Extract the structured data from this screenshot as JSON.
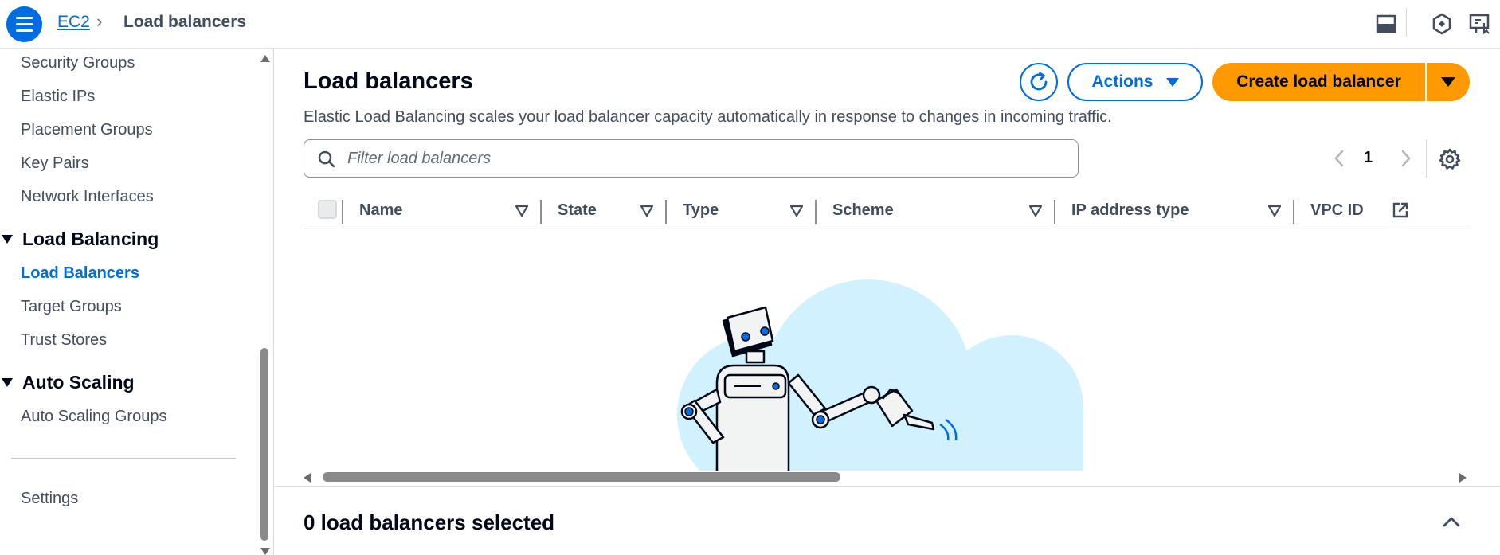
{
  "breadcrumb": {
    "parent": "EC2",
    "separator": "›",
    "current": "Load balancers"
  },
  "sidebar": {
    "items_top": [
      {
        "label": "Security Groups"
      },
      {
        "label": "Elastic IPs"
      },
      {
        "label": "Placement Groups"
      },
      {
        "label": "Key Pairs"
      },
      {
        "label": "Network Interfaces"
      }
    ],
    "section_load_balancing": "Load Balancing",
    "items_lb": [
      {
        "label": "Load Balancers",
        "active": true
      },
      {
        "label": "Target Groups"
      },
      {
        "label": "Trust Stores"
      }
    ],
    "section_auto_scaling": "Auto Scaling",
    "items_as": [
      {
        "label": "Auto Scaling Groups"
      }
    ],
    "settings": "Settings"
  },
  "main": {
    "title": "Load balancers",
    "description": "Elastic Load Balancing scales your load balancer capacity automatically in response to changes in incoming traffic.",
    "actions_label": "Actions",
    "create_label": "Create load balancer",
    "filter_placeholder": "Filter load balancers",
    "page_number": "1",
    "columns": [
      "Name",
      "State",
      "Type",
      "Scheme",
      "IP address type",
      "VPC ID"
    ]
  },
  "bottom": {
    "selected_text": "0 load balancers selected"
  },
  "colors": {
    "accent": "#006ce0",
    "primary_button": "#ff9900",
    "illustration_cloud": "#d1f1ff"
  },
  "icons": [
    "menu-icon",
    "chevron-right-icon",
    "split-panel-icon",
    "hexagon-icon",
    "display-icon",
    "refresh-icon",
    "search-icon",
    "settings-gear-icon",
    "external-link-icon",
    "sort-icon",
    "chevron-up-icon"
  ]
}
